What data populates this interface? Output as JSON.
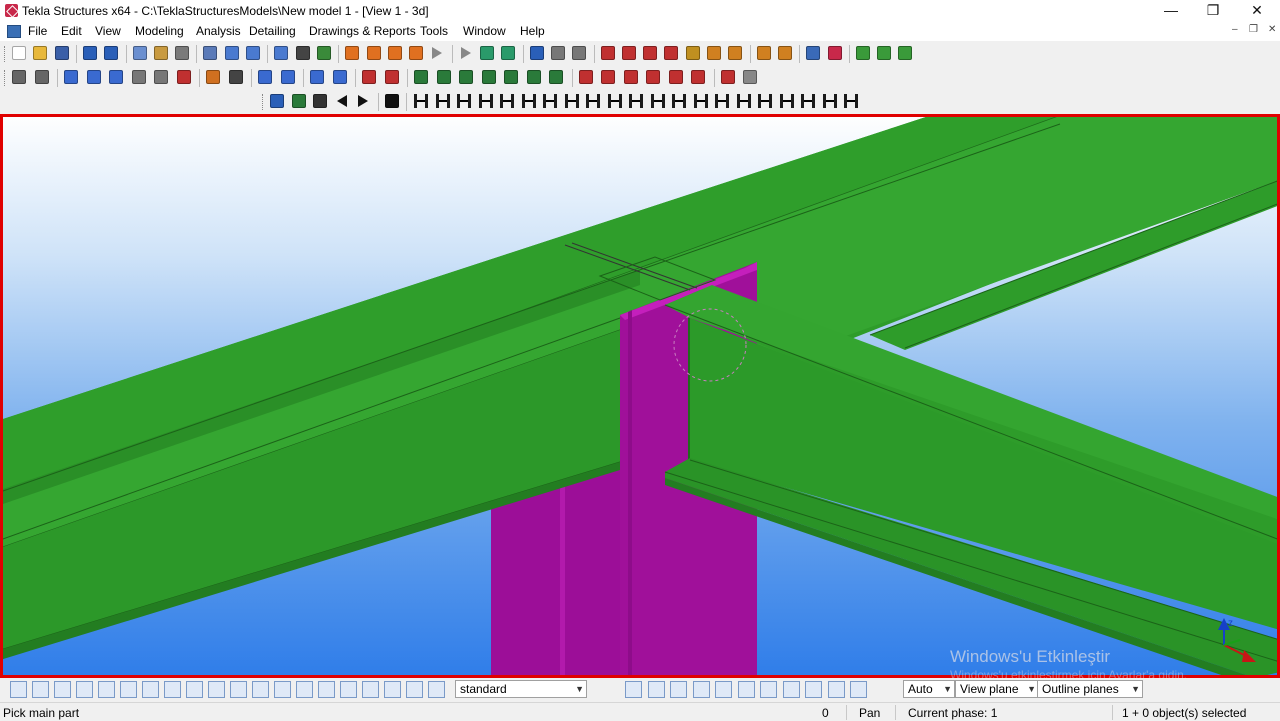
{
  "window": {
    "title": "Tekla Structures x64 - C:\\TeklaStructuresModels\\New model 1 - [View 1 - 3d]",
    "controls": {
      "minimize": "—",
      "restore": "❐",
      "close": "✕"
    }
  },
  "menu": {
    "items": [
      "File",
      "Edit",
      "View",
      "Modeling",
      "Analysis",
      "Detailing",
      "Drawings & Reports",
      "Tools",
      "Window",
      "Help"
    ],
    "mdi_controls": [
      "‒",
      "❐",
      "✕"
    ]
  },
  "toolbars": {
    "row1_icons": [
      "new-icon",
      "open-icon",
      "save-icon",
      "undo-icon",
      "redo-icon",
      "copy-icon",
      "paste-icon",
      "print-icon",
      "properties-icon",
      "window-icon",
      "window-icon",
      "window-icon",
      "cut-icon",
      "select-icon",
      "drawing-icon",
      "drawing-icon",
      "drawing-icon",
      "drawing-icon",
      "arrow-icon",
      "arrow-icon",
      "snap-icon",
      "snap-icon",
      "help-icon",
      "grid-icon",
      "grid-icon",
      "line-icon",
      "line-icon",
      "line-icon",
      "line-icon",
      "pick-icon",
      "clash-icon",
      "clash-icon",
      "clash-icon",
      "clash-icon",
      "report-icon",
      "tekla-icon",
      "macro-icon",
      "macro-icon",
      "macro-icon"
    ],
    "row2_icons": [
      "tool-icon",
      "tool-icon",
      "column-icon",
      "beam-icon",
      "beam-icon",
      "plate-icon",
      "plate-icon",
      "bolt-icon",
      "weld-icon",
      "cut-icon",
      "column-icon",
      "beam-icon",
      "beam-icon",
      "beam-icon",
      "rebar-icon",
      "rebar-icon",
      "component-icon",
      "component-icon",
      "component-icon",
      "component-icon",
      "component-icon",
      "component-icon",
      "component-icon",
      "measure-icon",
      "measure-icon",
      "measure-icon",
      "measure-icon",
      "measure-icon",
      "measure-icon",
      "measure-icon",
      "circle-icon"
    ],
    "row3_icons": [
      "first-icon",
      "step-icon",
      "binoculars-icon",
      "back-arrow-icon",
      "forward-arrow-icon",
      "one-icon",
      "connection-icon",
      "connection-icon",
      "connection-icon",
      "connection-icon",
      "connection-icon",
      "connection-icon",
      "connection-icon",
      "connection-icon",
      "connection-icon",
      "connection-icon",
      "connection-icon",
      "connection-icon",
      "connection-icon",
      "connection-icon",
      "connection-icon",
      "connection-icon",
      "connection-icon",
      "connection-icon",
      "connection-icon",
      "connection-icon",
      "connection-icon"
    ]
  },
  "viewport": {
    "watermark": "Windows'u Etkinleştir",
    "watermark_sub": "Windows'u etkinleştirmek için Ayarlar'a gidin.",
    "colors": {
      "beam": "#2e9c2a",
      "column": "#a0109a",
      "border": "#e00000"
    }
  },
  "bottombar": {
    "select_filter": "standard",
    "snap_depth": "Auto",
    "plane": "View plane",
    "plane_type": "Outline planes"
  },
  "statusbar": {
    "prompt": "Pick main part",
    "value": "0",
    "mode": "Pan",
    "phase": "Current phase: 1",
    "selection": "1 + 0 object(s) selected"
  }
}
